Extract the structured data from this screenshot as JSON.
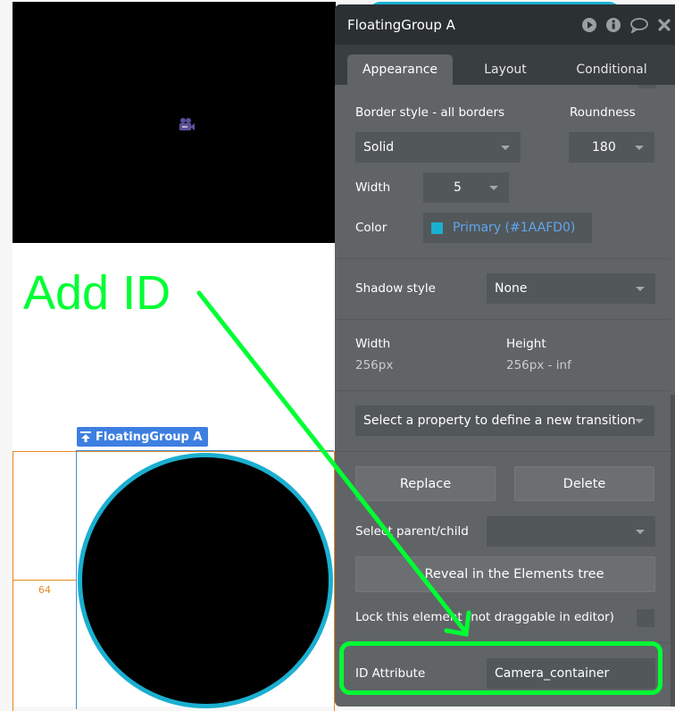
{
  "canvas": {
    "video_placeholder_icon": "video-camera-icon",
    "element_label": "FloatingGroup A",
    "distance_label": "64"
  },
  "annotation": {
    "text": "Add ID",
    "color": "#00ff33"
  },
  "panel": {
    "title": "FloatingGroup A",
    "header_icons": [
      "play-icon",
      "info-icon",
      "comment-icon",
      "close-icon"
    ],
    "tabs": [
      {
        "label": "Appearance",
        "active": true
      },
      {
        "label": "Layout",
        "active": false
      },
      {
        "label": "Conditional",
        "active": false
      }
    ],
    "border": {
      "style_label": "Border style - all borders",
      "style_value": "Solid",
      "roundness_label": "Roundness",
      "roundness_value": "180",
      "width_label": "Width",
      "width_value": "5",
      "color_label": "Color",
      "color_value": "Primary (#1AAFD0)",
      "color_hex": "#1AAFD0"
    },
    "shadow": {
      "label": "Shadow style",
      "value": "None"
    },
    "size": {
      "width_label": "Width",
      "width_value": "256px",
      "height_label": "Height",
      "height_value": "256px - inf"
    },
    "transition": {
      "placeholder": "Select a property to define a new transition"
    },
    "actions": {
      "replace": "Replace",
      "delete": "Delete",
      "select_parent_label": "Select parent/child",
      "select_parent_value": "",
      "reveal": "Reveal in the Elements tree",
      "lock_label": "Lock this element (not draggable in editor)",
      "lock_checked": false
    },
    "id_attribute": {
      "label": "ID Attribute",
      "value": "Camera_container"
    }
  }
}
